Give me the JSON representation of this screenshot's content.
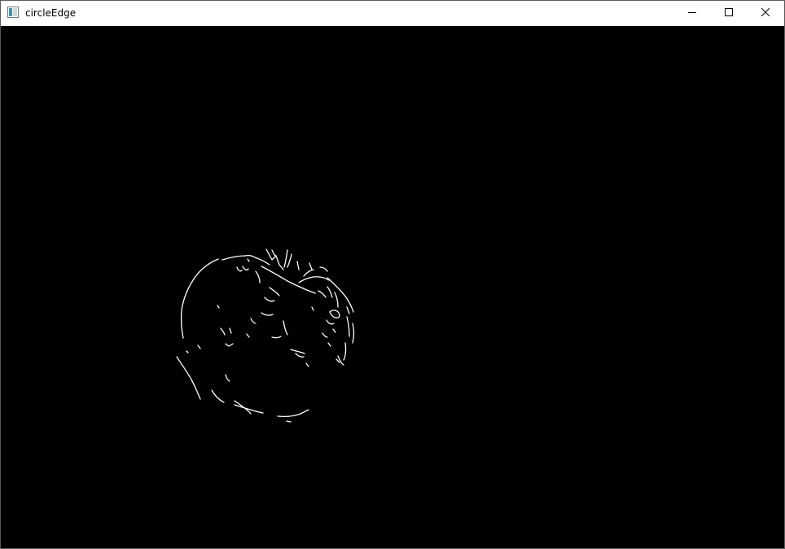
{
  "window": {
    "title": "circleEdge",
    "icon": "app-window-icon",
    "controls": {
      "minimize": "minimize-icon",
      "maximize": "maximize-icon",
      "close": "close-icon"
    }
  },
  "canvas": {
    "background": "#000000",
    "edge_color": "#ffffff",
    "content": "canny-edge-map-of-circular-object"
  }
}
